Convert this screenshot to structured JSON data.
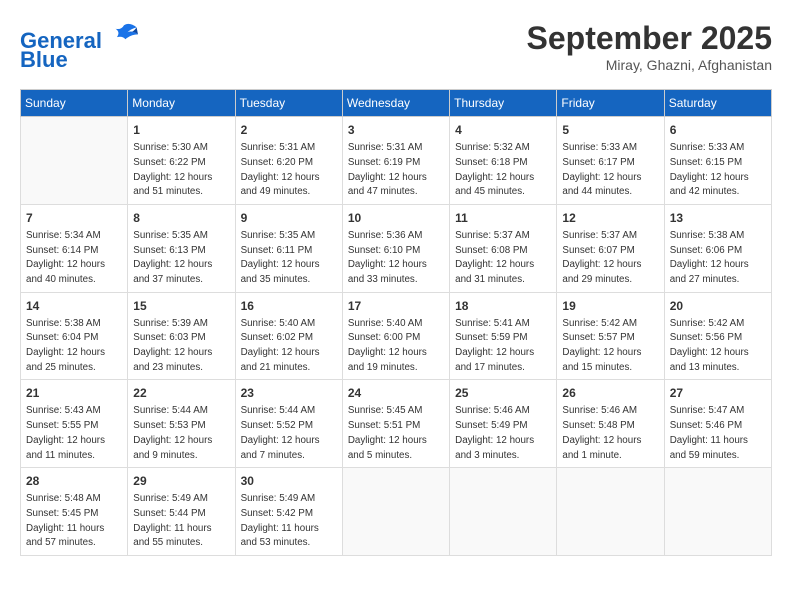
{
  "header": {
    "logo_line1": "General",
    "logo_line2": "Blue",
    "month": "September 2025",
    "location": "Miray, Ghazni, Afghanistan"
  },
  "days_of_week": [
    "Sunday",
    "Monday",
    "Tuesday",
    "Wednesday",
    "Thursday",
    "Friday",
    "Saturday"
  ],
  "weeks": [
    [
      {
        "day": "",
        "info": ""
      },
      {
        "day": "1",
        "info": "Sunrise: 5:30 AM\nSunset: 6:22 PM\nDaylight: 12 hours\nand 51 minutes."
      },
      {
        "day": "2",
        "info": "Sunrise: 5:31 AM\nSunset: 6:20 PM\nDaylight: 12 hours\nand 49 minutes."
      },
      {
        "day": "3",
        "info": "Sunrise: 5:31 AM\nSunset: 6:19 PM\nDaylight: 12 hours\nand 47 minutes."
      },
      {
        "day": "4",
        "info": "Sunrise: 5:32 AM\nSunset: 6:18 PM\nDaylight: 12 hours\nand 45 minutes."
      },
      {
        "day": "5",
        "info": "Sunrise: 5:33 AM\nSunset: 6:17 PM\nDaylight: 12 hours\nand 44 minutes."
      },
      {
        "day": "6",
        "info": "Sunrise: 5:33 AM\nSunset: 6:15 PM\nDaylight: 12 hours\nand 42 minutes."
      }
    ],
    [
      {
        "day": "7",
        "info": "Sunrise: 5:34 AM\nSunset: 6:14 PM\nDaylight: 12 hours\nand 40 minutes."
      },
      {
        "day": "8",
        "info": "Sunrise: 5:35 AM\nSunset: 6:13 PM\nDaylight: 12 hours\nand 37 minutes."
      },
      {
        "day": "9",
        "info": "Sunrise: 5:35 AM\nSunset: 6:11 PM\nDaylight: 12 hours\nand 35 minutes."
      },
      {
        "day": "10",
        "info": "Sunrise: 5:36 AM\nSunset: 6:10 PM\nDaylight: 12 hours\nand 33 minutes."
      },
      {
        "day": "11",
        "info": "Sunrise: 5:37 AM\nSunset: 6:08 PM\nDaylight: 12 hours\nand 31 minutes."
      },
      {
        "day": "12",
        "info": "Sunrise: 5:37 AM\nSunset: 6:07 PM\nDaylight: 12 hours\nand 29 minutes."
      },
      {
        "day": "13",
        "info": "Sunrise: 5:38 AM\nSunset: 6:06 PM\nDaylight: 12 hours\nand 27 minutes."
      }
    ],
    [
      {
        "day": "14",
        "info": "Sunrise: 5:38 AM\nSunset: 6:04 PM\nDaylight: 12 hours\nand 25 minutes."
      },
      {
        "day": "15",
        "info": "Sunrise: 5:39 AM\nSunset: 6:03 PM\nDaylight: 12 hours\nand 23 minutes."
      },
      {
        "day": "16",
        "info": "Sunrise: 5:40 AM\nSunset: 6:02 PM\nDaylight: 12 hours\nand 21 minutes."
      },
      {
        "day": "17",
        "info": "Sunrise: 5:40 AM\nSunset: 6:00 PM\nDaylight: 12 hours\nand 19 minutes."
      },
      {
        "day": "18",
        "info": "Sunrise: 5:41 AM\nSunset: 5:59 PM\nDaylight: 12 hours\nand 17 minutes."
      },
      {
        "day": "19",
        "info": "Sunrise: 5:42 AM\nSunset: 5:57 PM\nDaylight: 12 hours\nand 15 minutes."
      },
      {
        "day": "20",
        "info": "Sunrise: 5:42 AM\nSunset: 5:56 PM\nDaylight: 12 hours\nand 13 minutes."
      }
    ],
    [
      {
        "day": "21",
        "info": "Sunrise: 5:43 AM\nSunset: 5:55 PM\nDaylight: 12 hours\nand 11 minutes."
      },
      {
        "day": "22",
        "info": "Sunrise: 5:44 AM\nSunset: 5:53 PM\nDaylight: 12 hours\nand 9 minutes."
      },
      {
        "day": "23",
        "info": "Sunrise: 5:44 AM\nSunset: 5:52 PM\nDaylight: 12 hours\nand 7 minutes."
      },
      {
        "day": "24",
        "info": "Sunrise: 5:45 AM\nSunset: 5:51 PM\nDaylight: 12 hours\nand 5 minutes."
      },
      {
        "day": "25",
        "info": "Sunrise: 5:46 AM\nSunset: 5:49 PM\nDaylight: 12 hours\nand 3 minutes."
      },
      {
        "day": "26",
        "info": "Sunrise: 5:46 AM\nSunset: 5:48 PM\nDaylight: 12 hours\nand 1 minute."
      },
      {
        "day": "27",
        "info": "Sunrise: 5:47 AM\nSunset: 5:46 PM\nDaylight: 11 hours\nand 59 minutes."
      }
    ],
    [
      {
        "day": "28",
        "info": "Sunrise: 5:48 AM\nSunset: 5:45 PM\nDaylight: 11 hours\nand 57 minutes."
      },
      {
        "day": "29",
        "info": "Sunrise: 5:49 AM\nSunset: 5:44 PM\nDaylight: 11 hours\nand 55 minutes."
      },
      {
        "day": "30",
        "info": "Sunrise: 5:49 AM\nSunset: 5:42 PM\nDaylight: 11 hours\nand 53 minutes."
      },
      {
        "day": "",
        "info": ""
      },
      {
        "day": "",
        "info": ""
      },
      {
        "day": "",
        "info": ""
      },
      {
        "day": "",
        "info": ""
      }
    ]
  ]
}
